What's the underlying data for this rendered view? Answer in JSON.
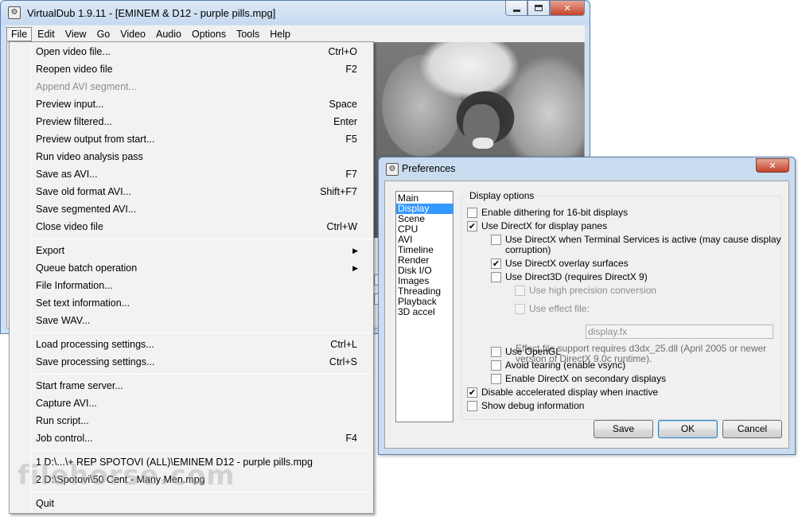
{
  "main_window": {
    "title": "VirtualDub 1.9.11 - [EMINEM & D12 - purple pills.mpg]",
    "menubar": [
      "File",
      "Edit",
      "View",
      "Go",
      "Video",
      "Audio",
      "Options",
      "Tools",
      "Help"
    ]
  },
  "file_menu": {
    "items": [
      {
        "label": "Open video file...",
        "accel": "Ctrl+O"
      },
      {
        "label": "Reopen video file",
        "accel": "F2"
      },
      {
        "label": "Append AVI segment...",
        "accel": "",
        "disabled": true
      },
      {
        "label": "Preview input...",
        "accel": "Space"
      },
      {
        "label": "Preview filtered...",
        "accel": "Enter"
      },
      {
        "label": "Preview output from start...",
        "accel": "F5"
      },
      {
        "label": "Run video analysis pass",
        "accel": ""
      },
      {
        "label": "Save as AVI...",
        "accel": "F7"
      },
      {
        "label": "Save old format AVI...",
        "accel": "Shift+F7"
      },
      {
        "label": "Save segmented AVI...",
        "accel": ""
      },
      {
        "label": "Close video file",
        "accel": "Ctrl+W"
      },
      {
        "label": "Export",
        "accel": ""
      },
      {
        "label": "Queue batch operation",
        "accel": ""
      },
      {
        "label": "File Information...",
        "accel": ""
      },
      {
        "label": "Set text information...",
        "accel": ""
      },
      {
        "label": "Save WAV...",
        "accel": ""
      },
      {
        "label": "Load processing settings...",
        "accel": "Ctrl+L"
      },
      {
        "label": "Save processing settings...",
        "accel": "Ctrl+S"
      },
      {
        "label": "Start frame server...",
        "accel": ""
      },
      {
        "label": "Capture AVI...",
        "accel": ""
      },
      {
        "label": "Run script...",
        "accel": ""
      },
      {
        "label": "Job control...",
        "accel": "F4"
      },
      {
        "label": "1 D:\\...\\+ REP SPOTOVI (ALL)\\EMINEM  D12 - purple pills.mpg",
        "accel": ""
      },
      {
        "label": "2 D:\\Spotovi\\50 Cent - Many Men.mpg",
        "accel": ""
      },
      {
        "label": "Quit",
        "accel": ""
      }
    ]
  },
  "watermark": "filehorse.com",
  "preferences": {
    "title": "Preferences",
    "categories": [
      "Main",
      "Display",
      "Scene",
      "CPU",
      "AVI",
      "Timeline",
      "Render",
      "Disk I/O",
      "Images",
      "Threading",
      "Playback",
      "3D accel"
    ],
    "selected_category": "Display",
    "group_title": "Display options",
    "options": [
      {
        "label": "Enable dithering for 16-bit displays",
        "checked": false
      },
      {
        "label": "Use DirectX for display panes",
        "checked": true
      },
      {
        "label": "Use DirectX when Terminal Services is active (may cause display",
        "label2": "corruption)",
        "checked": false
      },
      {
        "label": "Use DirectX overlay surfaces",
        "checked": true
      },
      {
        "label": "Use Direct3D (requires DirectX 9)",
        "checked": false
      },
      {
        "label": "Use high precision conversion",
        "checked": false,
        "disabled": true
      },
      {
        "label": "Use effect file:",
        "checked": false,
        "disabled": true
      },
      {
        "label": "Use OpenGL",
        "checked": false
      },
      {
        "label": "Avoid tearing (enable vsync)",
        "checked": false
      },
      {
        "label": "Enable DirectX on secondary displays",
        "checked": false
      },
      {
        "label": "Disable accelerated display when inactive",
        "checked": true
      },
      {
        "label": "Show debug information",
        "checked": false
      }
    ],
    "effect_file_value": "display.fx",
    "effect_note": "Effect file support requires d3dx_25.dll (April 2005 or newer version of DirectX 9.0c runtime).",
    "buttons": {
      "save": "Save",
      "ok": "OK",
      "cancel": "Cancel"
    }
  }
}
